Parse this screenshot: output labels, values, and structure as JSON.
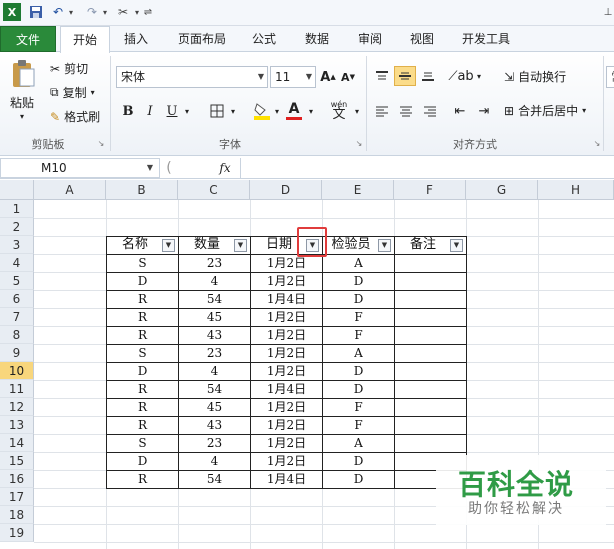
{
  "quick_access": {
    "excel_icon": "excel-logo-icon",
    "save": "save-icon",
    "undo": "undo-icon",
    "redo": "redo-icon",
    "tool": "format-painter-icon"
  },
  "tabs": [
    "文件",
    "开始",
    "插入",
    "页面布局",
    "公式",
    "数据",
    "审阅",
    "视图",
    "开发工具"
  ],
  "ribbon": {
    "clipboard": {
      "paste": "粘贴",
      "cut": "剪切",
      "copy": "复制",
      "format_painter": "格式刷",
      "label": "剪贴板"
    },
    "font": {
      "name": "宋体",
      "size": "11",
      "bold": "B",
      "italic": "I",
      "underline": "U",
      "grow": "A",
      "shrink": "A",
      "label": "字体",
      "wen": "wén",
      "wen_char": "文"
    },
    "align": {
      "wrap": "自动换行",
      "merge": "合并后居中",
      "label": "对齐方式"
    },
    "number": {
      "partial": "常"
    }
  },
  "formula_bar": {
    "name_box": "M10",
    "fx": "fx",
    "value": ""
  },
  "columns": [
    "A",
    "B",
    "C",
    "D",
    "E",
    "F",
    "G",
    "H"
  ],
  "rows": [
    "1",
    "2",
    "3",
    "4",
    "5",
    "6",
    "7",
    "8",
    "9",
    "10",
    "11",
    "12",
    "13",
    "14",
    "15",
    "16",
    "17",
    "18",
    "19"
  ],
  "selected_row": "10",
  "table": {
    "headers": [
      "名称",
      "数量",
      "日期",
      "检验员",
      "备注"
    ],
    "rows": [
      [
        "S",
        "23",
        "1月2日",
        "A",
        ""
      ],
      [
        "D",
        "4",
        "1月2日",
        "D",
        ""
      ],
      [
        "R",
        "54",
        "1月4日",
        "D",
        ""
      ],
      [
        "R",
        "45",
        "1月2日",
        "F",
        ""
      ],
      [
        "R",
        "43",
        "1月2日",
        "F",
        ""
      ],
      [
        "S",
        "23",
        "1月2日",
        "A",
        ""
      ],
      [
        "D",
        "4",
        "1月2日",
        "D",
        ""
      ],
      [
        "R",
        "54",
        "1月4日",
        "D",
        ""
      ],
      [
        "R",
        "45",
        "1月2日",
        "F",
        ""
      ],
      [
        "R",
        "43",
        "1月2日",
        "F",
        ""
      ],
      [
        "S",
        "23",
        "1月2日",
        "A",
        ""
      ],
      [
        "D",
        "4",
        "1月2日",
        "D",
        ""
      ],
      [
        "R",
        "54",
        "1月4日",
        "D",
        ""
      ]
    ]
  },
  "watermark": {
    "title": "百科全说",
    "subtitle": "助你轻松解决"
  },
  "colors": {
    "file_tab": "#2a8a3a",
    "highlight": "#e03c3c",
    "selected_row": "#f8d67c",
    "watermark": "#2f9b46"
  }
}
